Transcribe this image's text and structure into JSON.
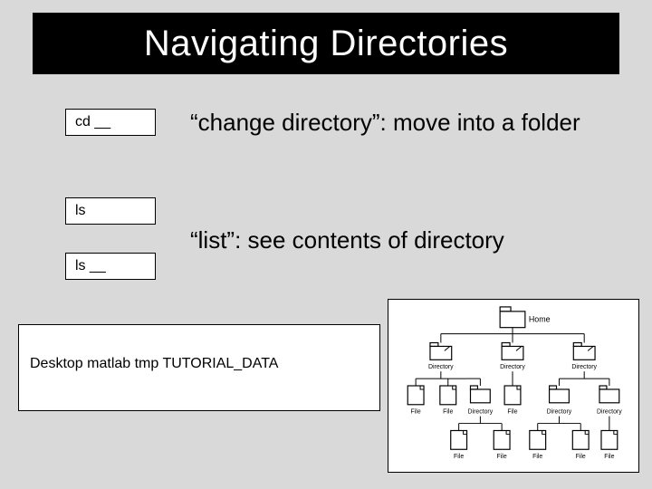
{
  "title": "Navigating Directories",
  "commands": {
    "cd": {
      "label": "cd  __",
      "description": "“change directory”:  move into a folder"
    },
    "ls1": {
      "label": "ls"
    },
    "ls2": {
      "label": "ls __"
    },
    "ls_description": "“list”:  see contents of directory"
  },
  "output_line": "Desktop   matlab   tmp   TUTORIAL_DATA",
  "tree": {
    "root": "Home",
    "row1": [
      "Directory",
      "Directory",
      "Directory"
    ],
    "row2": [
      "File",
      "File",
      "Directory",
      "File",
      "Directory",
      "Directory"
    ],
    "row3": [
      "File",
      "File",
      "File",
      "File",
      "File"
    ]
  }
}
